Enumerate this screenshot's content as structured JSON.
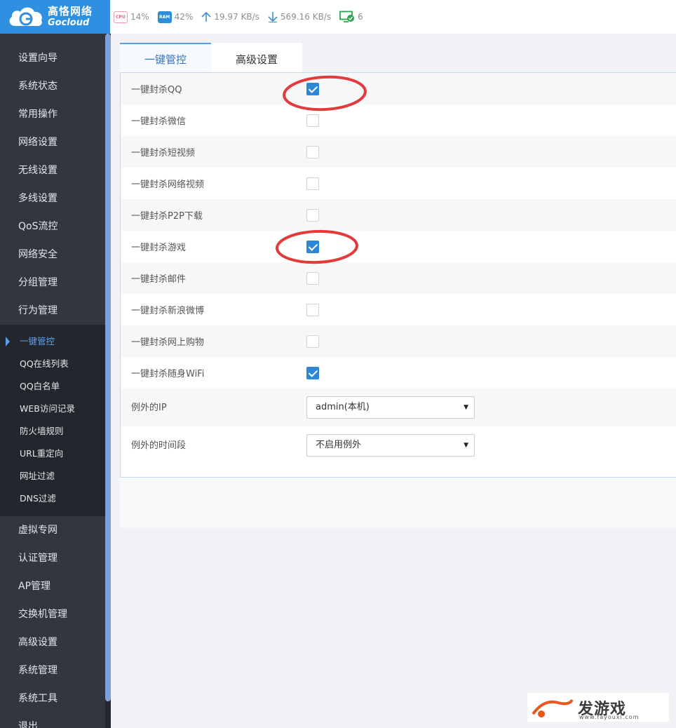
{
  "brand": {
    "name_cn": "高恪网络",
    "name_en": "Gocloud"
  },
  "status": {
    "cpu_chip": "CPU",
    "cpu": "14%",
    "ram_chip": "RAM",
    "ram": "42%",
    "upload": "19.97 KB/s",
    "download": "569.16 KB/s",
    "devices": "6"
  },
  "sidebar": {
    "items_top": [
      "设置向导",
      "系统状态",
      "常用操作",
      "网络设置",
      "无线设置",
      "多线设置",
      "QoS流控",
      "网络安全",
      "分组管理",
      "行为管理"
    ],
    "sub_items": [
      "一键管控",
      "QQ在线列表",
      "QQ白名单",
      "WEB访问记录",
      "防火墙规则",
      "URL重定向",
      "网址过滤",
      "DNS过滤"
    ],
    "items_bottom": [
      "虚拟专网",
      "认证管理",
      "AP管理",
      "交换机管理",
      "高级设置",
      "系统管理",
      "系统工具",
      "退出"
    ]
  },
  "tabs": [
    "一键管控",
    "高级设置"
  ],
  "form": {
    "toggles": [
      {
        "label": "一键封杀QQ",
        "checked": true
      },
      {
        "label": "一键封杀微信",
        "checked": false
      },
      {
        "label": "一键封杀短视频",
        "checked": false
      },
      {
        "label": "一键封杀网络视频",
        "checked": false
      },
      {
        "label": "一键封杀P2P下载",
        "checked": false
      },
      {
        "label": "一键封杀游戏",
        "checked": true
      },
      {
        "label": "一键封杀邮件",
        "checked": false
      },
      {
        "label": "一键封杀新浪微博",
        "checked": false
      },
      {
        "label": "一键封杀网上购物",
        "checked": false
      },
      {
        "label": "一键封杀随身WiFi",
        "checked": true
      }
    ],
    "exception_ip": {
      "label": "例外的IP",
      "value": "admin(本机)"
    },
    "exception_time": {
      "label": "例外的时间段",
      "value": "不启用例外"
    }
  },
  "colors": {
    "brand_blue": "#2f8fe0",
    "sidebar_bg": "#32363f",
    "check_blue": "#2d87d7",
    "annotation_red": "#e23b3b"
  },
  "watermark": {
    "main": "发游戏",
    "url": "www.fayouxi.com"
  }
}
